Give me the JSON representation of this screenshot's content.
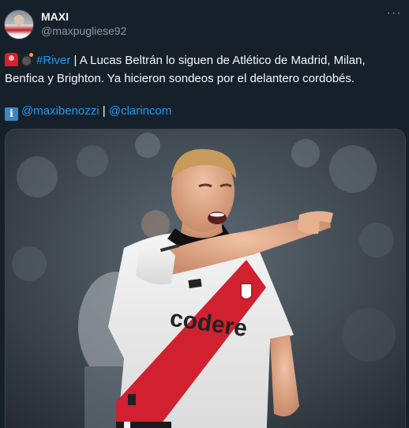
{
  "author": {
    "name": "MAXI",
    "handle": "@maxpugliese92",
    "avatar_icon": "profile-avatar"
  },
  "menu": {
    "more_icon": "more-horizontal-icon",
    "more_glyph": "···"
  },
  "tweet": {
    "emoji_1": "siren-emoji",
    "emoji_2": "bomb-emoji",
    "hashtag": "#River",
    "text_after_hashtag": " | A Lucas Beltrán lo siguen de Atlético de Madrid, Milan, Benfica y Brighton. Ya hicieron sondeos por el delantero cordobés.",
    "info_icon_glyph": "i",
    "mention_1": "@maxibenozzi",
    "separator": " | ",
    "mention_2": "@clarincom"
  },
  "media": {
    "jersey_sponsor": "codere"
  },
  "colors": {
    "background": "#15202b",
    "link": "#1d9bf0",
    "secondary_text": "#8b98a5",
    "jersey_band": "#d1202f"
  }
}
